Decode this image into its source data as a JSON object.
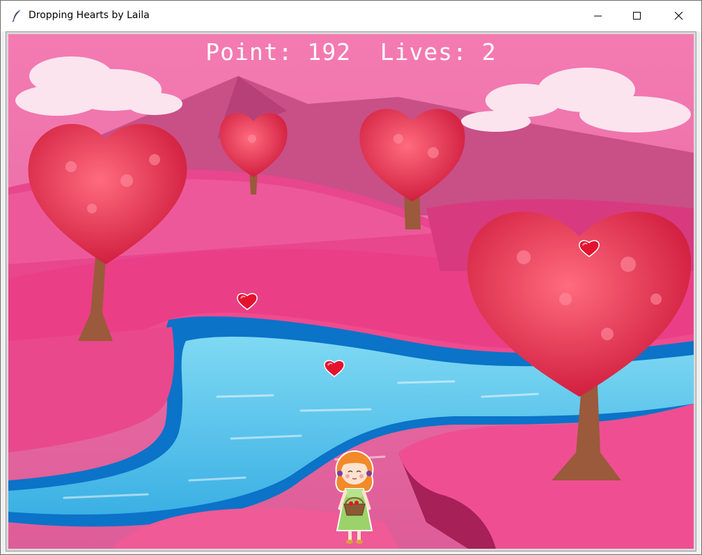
{
  "window": {
    "title": "Dropping Hearts by Laila",
    "icon": "feather-icon",
    "controls": [
      "minimize-icon",
      "maximize-icon",
      "close-icon"
    ]
  },
  "hud": {
    "point_label": "Point:",
    "point_value": "192",
    "lives_label": "Lives:",
    "lives_value": "2"
  },
  "colors": {
    "sky": "#e86aa3",
    "land": "#e83e86",
    "river": "#4fc3ea",
    "heart": "#e3132f"
  },
  "falling_hearts": [
    "heart-1",
    "heart-2",
    "heart-3"
  ],
  "player": "girl-with-basket"
}
